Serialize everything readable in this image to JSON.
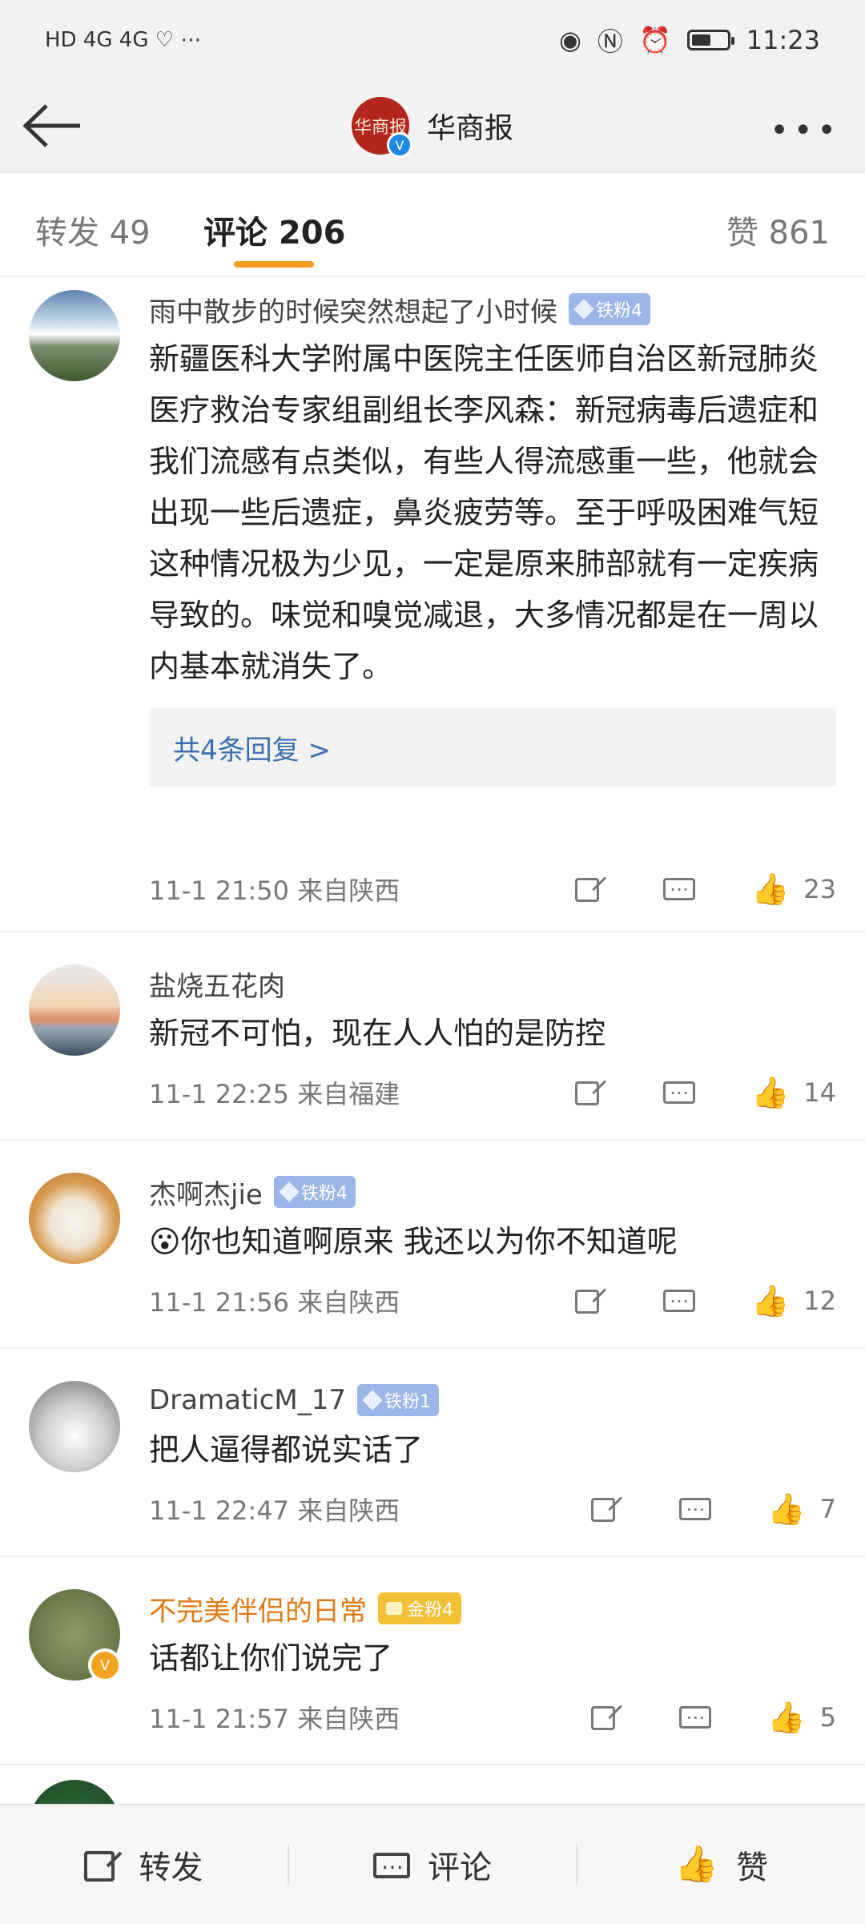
{
  "status_bar": {
    "left_text": "HD 4G 4G ♡ ⋯",
    "time": "11:23",
    "battery_level": 0.55
  },
  "navbar": {
    "title": "华商报",
    "logo_text": "华商报",
    "verified": "V"
  },
  "tabs": [
    {
      "label": "转发 49"
    },
    {
      "label": "评论 206",
      "active": true
    },
    {
      "label": "赞 861"
    }
  ],
  "comments": [
    {
      "user": "雨中散步的时候突然想起了小时候",
      "badge": "铁粉4",
      "text": "新疆医科大学附属中医院主任医师自治区新冠肺炎医疗救治专家组副组长李风森：新冠病毒后遗症和我们流感有点类似，有些人得流感重一些，他就会出现一些后遗症，鼻炎疲劳等。至于呼吸困难气短这种情况极为少见，一定是原来肺部就有一定疾病导致的。味觉和嗅觉减退，大多情况都是在一周以内基本就消失了。",
      "reply_label": "共4条回复 >",
      "time": "11-1 21:50 来自陕西",
      "likes": "23"
    },
    {
      "user": "盐烧五花肉",
      "badge": "",
      "text": "新冠不可怕，现在人人怕的是防控",
      "time": "11-1 22:25 来自福建",
      "likes": "14"
    },
    {
      "user": "杰啊杰jie",
      "badge": "铁粉4",
      "text": "😮你也知道啊原来 我还以为你不知道呢",
      "time": "11-1 21:56 来自陕西",
      "likes": "12"
    },
    {
      "user": "DramaticM_17",
      "badge": "铁粉1",
      "text": "把人逼得都说实话了",
      "time": "11-1 22:47 来自陕西",
      "likes": "7"
    },
    {
      "user": "不完美伴侣的日常",
      "badge": "金粉4",
      "verified": "V",
      "text": "话都让你们说完了",
      "time": "11-1 21:57 来自陕西",
      "likes": "5"
    }
  ],
  "bottom_bar": {
    "share": "转发",
    "comment": "评论",
    "like": "赞"
  },
  "icons": {
    "back": "arrow-left-icon",
    "more": "more-dots-icon",
    "share": "share-icon",
    "comment": "comment-icon",
    "like": "thumbs-up-icon"
  }
}
